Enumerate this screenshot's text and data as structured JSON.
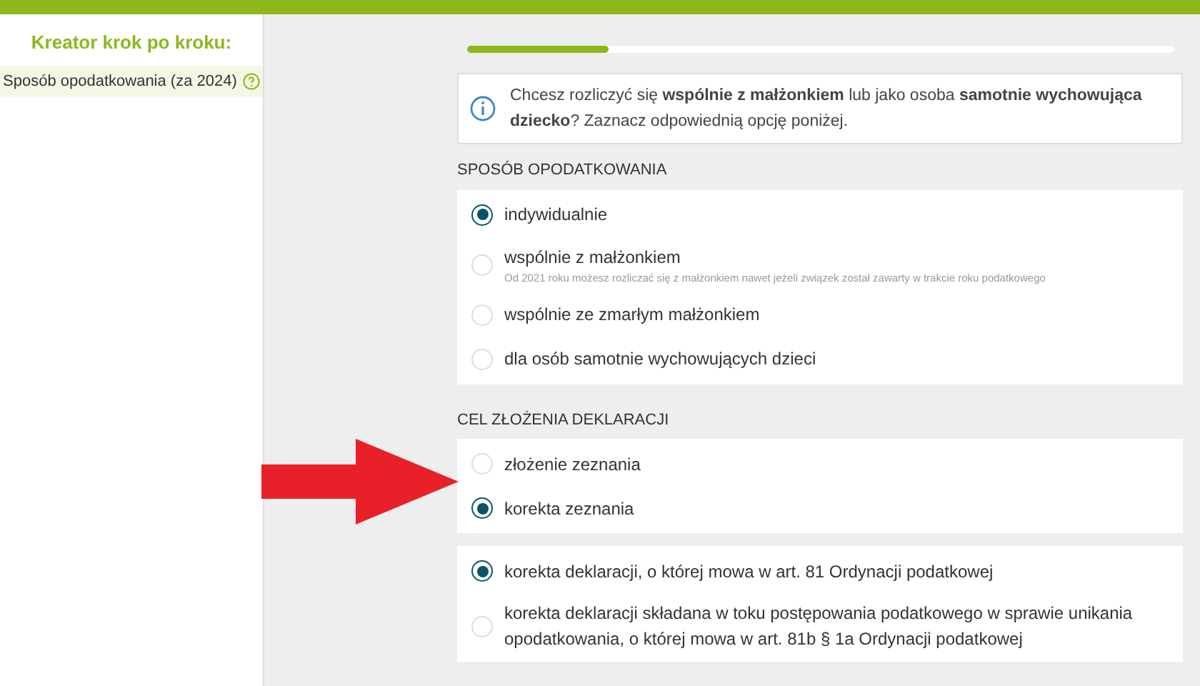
{
  "sidebar": {
    "title": "Kreator krok po kroku:",
    "items": [
      {
        "label": "Sposób opodatkowania (za 2024)",
        "selected": true
      }
    ]
  },
  "progress": {
    "level": 0.2
  },
  "info": {
    "text": "Chcesz rozliczyć się **wspólnie z małżonkiem** lub jako osoba **samotnie wychowująca dziecko**? Zaznacz odpowiednią opcję poniżej."
  },
  "sections": [
    {
      "title": "SPOSÓB OPODATKOWANIA",
      "groups": [
        [
          {
            "label": "indywidualnie",
            "selected": true
          },
          {
            "label": "wspólnie z małżonkiem",
            "hint": "Od 2021 roku możesz rozliczać się z małżonkiem nawet jeżeli związek został zawarty w trakcie roku podatkowego",
            "selected": false
          },
          {
            "label": "wspólnie ze zmarłym małżonkiem",
            "selected": false
          },
          {
            "label": "dla osób samotnie wychowujących dzieci",
            "selected": false
          }
        ]
      ]
    },
    {
      "title": "CEL ZŁOŻENIA DEKLARACJI",
      "groups": [
        [
          {
            "label": "złożenie zeznania",
            "selected": false
          },
          {
            "label": "korekta zeznania",
            "selected": true
          }
        ],
        [
          {
            "label": "korekta deklaracji, o której mowa w art. 81 Ordynacji podatkowej",
            "selected": true
          },
          {
            "label": "korekta deklaracji składana w toku postępowania podatkowego w sprawie unikania opodatkowania, o której mowa w art. 81b § 1a Ordynacji podatkowej",
            "selected": false
          }
        ]
      ]
    }
  ]
}
